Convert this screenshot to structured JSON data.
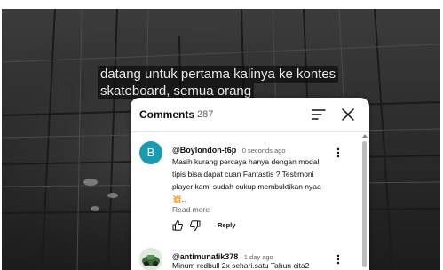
{
  "video": {
    "caption_line1": "datang untuk pertama kalinya ke kontes",
    "caption_line2": "skateboard, semua orang"
  },
  "comments_panel": {
    "title": "Comments",
    "count": "287",
    "sort_icon": "sort-icon",
    "close_icon": "close-icon",
    "comments": [
      {
        "avatar_letter": "B",
        "avatar_color": "#1a9bb0",
        "author": "@Boylondon-t6p",
        "time": "0 seconds ago",
        "text": "Masih kurang percaya hanya dengan modal tipis bisa dapat cuan Fantastis ? Testimoni player kami sudah cukup membuktikan nyaa 💥..",
        "read_more": "Read more",
        "reply_label": "Reply"
      },
      {
        "author": "@antimunafik378",
        "time": "1 day ago",
        "text": "Minum redbull 2x sehari.satu Tahun cita2"
      }
    ]
  }
}
